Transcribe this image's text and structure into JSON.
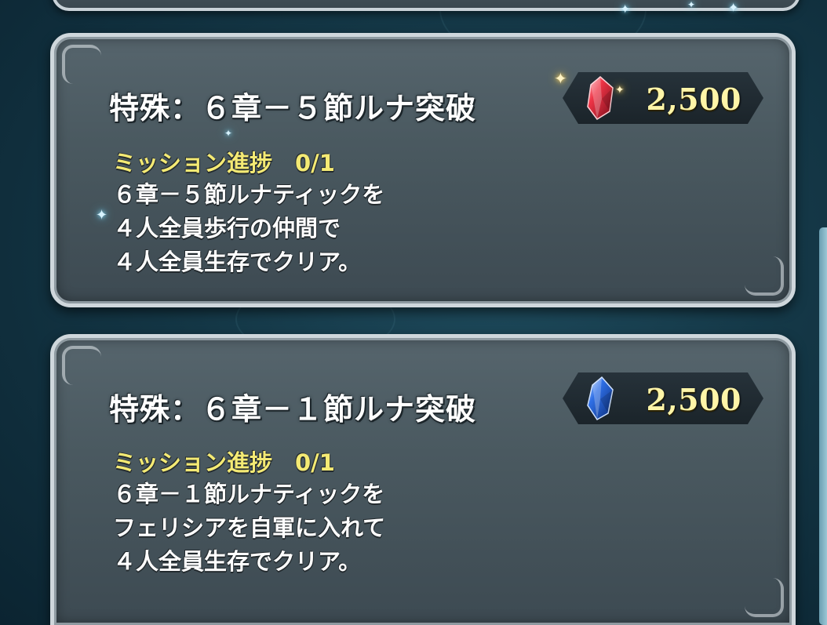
{
  "missions": [
    {
      "title": "特殊：６章－５節ルナ突破",
      "reward": {
        "icon": "red-orb-icon",
        "value": "2,500",
        "color": "#e0283c"
      },
      "progress_label": "ミッション進捗　0/1",
      "description": [
        "６章－５節ルナティックを",
        "４人全員歩行の仲間で",
        "４人全員生存でクリア。"
      ]
    },
    {
      "title": "特殊：６章－１節ルナ突破",
      "reward": {
        "icon": "blue-orb-icon",
        "value": "2,500",
        "color": "#2a66d8"
      },
      "progress_label": "ミッション進捗　0/1",
      "description": [
        "６章－１節ルナティックを",
        "フェリシアを自軍に入れて",
        "４人全員生存でクリア。"
      ]
    }
  ],
  "colors": {
    "background": "#143746",
    "card": "#4a5960",
    "card_border": "#cfd7dc",
    "progress_text": "#f4ea74",
    "reward_value": "#fff5a8"
  }
}
